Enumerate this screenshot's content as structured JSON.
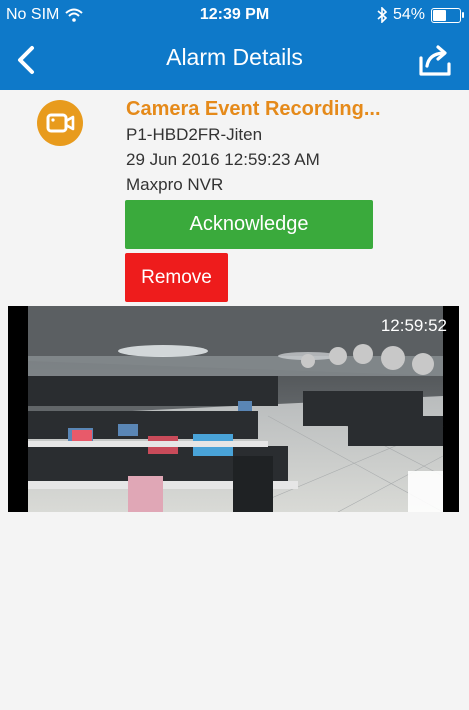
{
  "status_bar": {
    "carrier": "No SIM",
    "time": "12:39 PM",
    "battery_text": "54%",
    "battery_level": 0.54
  },
  "nav": {
    "title": "Alarm Details",
    "back_icon": "chevron-left-icon",
    "share_icon": "share-icon"
  },
  "alarm": {
    "icon": "video-camera-icon",
    "title": "Camera Event Recording...",
    "device": "P1-HBD2FR-Jiten",
    "datetime": "29 Jun 2016 12:59:23 AM",
    "source": "Maxpro NVR"
  },
  "actions": {
    "acknowledge_label": "Acknowledge",
    "remove_label": "Remove"
  },
  "video": {
    "timestamp": "12:59:52"
  },
  "colors": {
    "header": "#0e79c9",
    "accent_orange": "#e58a1a",
    "acknowledge_green": "#3aaa3c",
    "remove_red": "#ee1c1c"
  }
}
